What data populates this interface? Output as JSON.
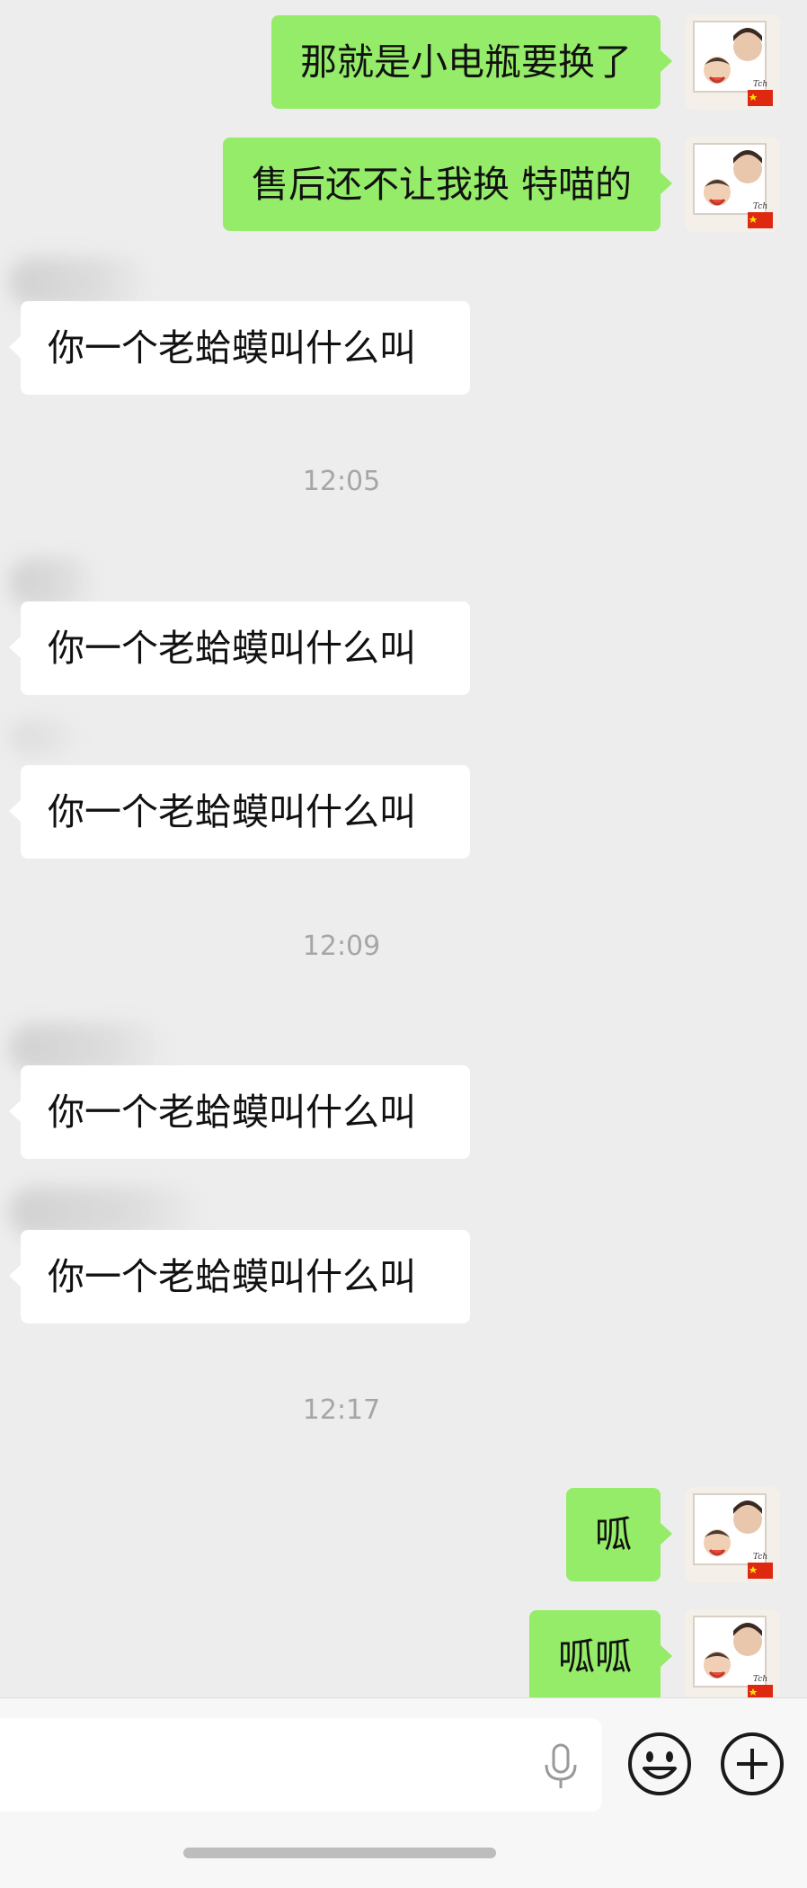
{
  "messages": [
    {
      "type": "out",
      "text": "那就是小电瓶要换了"
    },
    {
      "type": "out",
      "text": "售后还不让我换 特喵的"
    },
    {
      "type": "in",
      "text": "你一个老蛤蟆叫什么叫"
    },
    {
      "type": "time",
      "text": "12:05"
    },
    {
      "type": "in",
      "text": "你一个老蛤蟆叫什么叫"
    },
    {
      "type": "in",
      "text": "你一个老蛤蟆叫什么叫"
    },
    {
      "type": "time",
      "text": "12:09"
    },
    {
      "type": "in",
      "text": "你一个老蛤蟆叫什么叫"
    },
    {
      "type": "in",
      "text": "你一个老蛤蟆叫什么叫"
    },
    {
      "type": "time",
      "text": "12:17"
    },
    {
      "type": "out",
      "text": "呱"
    },
    {
      "type": "out",
      "text": "呱呱"
    }
  ],
  "input": {
    "value": "",
    "mic_icon": "microphone-icon",
    "emoji_icon": "emoji-icon",
    "plus_icon": "plus-icon"
  },
  "colors": {
    "background": "#ededed",
    "outgoing_bubble": "#95ec69",
    "incoming_bubble": "#ffffff",
    "timestamp_text": "#a6a6a6"
  }
}
